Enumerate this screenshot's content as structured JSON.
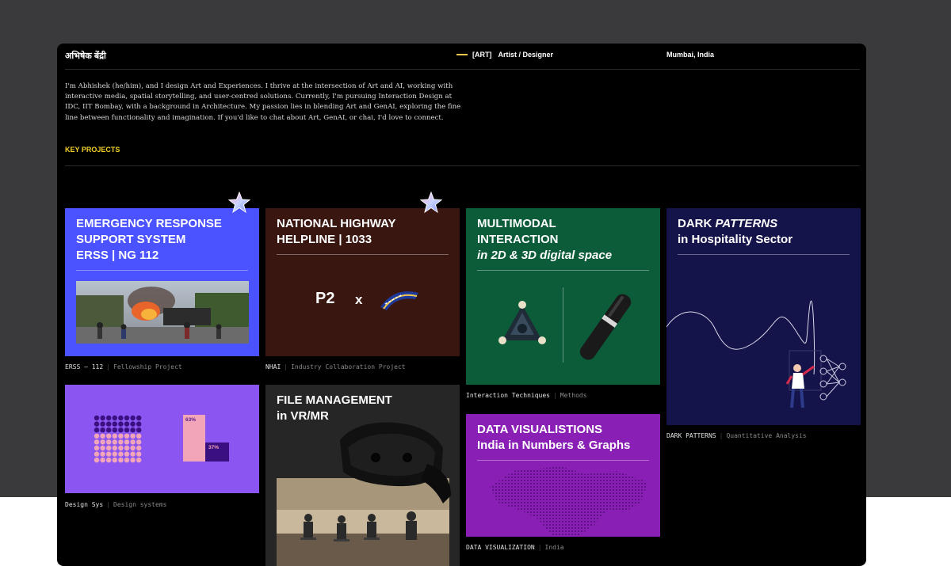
{
  "header": {
    "brand": "अभिषेक बेंद्री",
    "tag_code": "[ART]",
    "tag_role": "Artist / Designer",
    "location": "Mumbai, India"
  },
  "bio": "I'm Abhishek (he/him), and I design Art and Experiences. I thrive at the intersection of Art and AI, working with interactive media, spatial storytelling, and user-centred solutions. Currently, I'm pursuing Interaction Design at IDC, IIT Bombay, with a background in Architecture. My passion lies in blending Art and GenAI, exploring the fine line between functionality and imagination. If you'd like to chat about Art, GenAI, or chai, I'd love to connect.",
  "section_label": "KEY PROJECTS",
  "colors": {
    "accent": "#f2d029",
    "erss": "#4b52ff",
    "nhai": "#3a1611",
    "multimodal": "#0c5c3a",
    "dark_patterns": "#15144a",
    "design_sys": "#8a55f0",
    "file_mgmt": "#262626",
    "data_vis": "#8a1fb5"
  },
  "projects": {
    "erss": {
      "line1": "EMERGENCY RESPONSE",
      "line2": "SUPPORT SYSTEM",
      "line3": "ERSS | NG 112",
      "caption_code": "ERSS – 112",
      "caption_type": "Fellowship Project",
      "icon": "star-sparkle-icon"
    },
    "nhai": {
      "line1": "NATIONAL HIGHWAY",
      "line2": "HELPLINE  |  1033",
      "logo_text": "P2",
      "logo_x": "x",
      "caption_code": "NHAI",
      "caption_type": "Industry Collaboration Project",
      "icon": "star-sparkle-icon"
    },
    "multimodal": {
      "line1": "MULTIMODAL",
      "line2": "INTERACTION",
      "line3": "in 2D & 3D digital space",
      "caption_code": "Interaction Techniques",
      "caption_type": "Methods"
    },
    "dark_patterns": {
      "line1_a": "DARK ",
      "line1_b": "PATTERNS",
      "line2": "in Hospitality Sector",
      "caption_code": "DARK PATTERNS",
      "caption_type": "Quantitative Analysis"
    },
    "design_sys": {
      "pct_high": "63%",
      "pct_low": "37%",
      "caption_code": "Design Sys",
      "caption_type": "Design systems"
    },
    "file_mgmt": {
      "line1": "FILE MANAGEMENT",
      "line2": "in VR/MR"
    },
    "data_vis": {
      "line1": "DATA VISUALISTIONS",
      "line2": "India in Numbers & Graphs",
      "caption_code": "DATA VISUALIZATION",
      "caption_type": "India"
    }
  }
}
